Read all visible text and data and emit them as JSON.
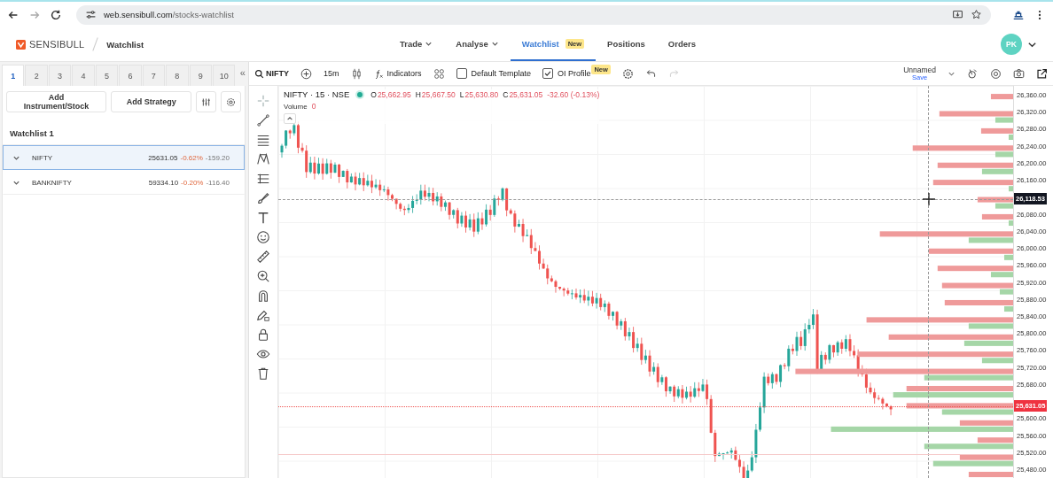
{
  "browser": {
    "url_host": "web.sensibull.com",
    "url_path": "/stocks-watchlist"
  },
  "header": {
    "logo": "SENSIBULL",
    "page": "Watchlist",
    "avatar": "PK",
    "nav": [
      {
        "label": "Trade",
        "dropdown": true,
        "selected": false
      },
      {
        "label": "Analyse",
        "dropdown": true,
        "selected": false
      },
      {
        "label": "Watchlist",
        "dropdown": false,
        "selected": true,
        "badge": "New"
      },
      {
        "label": "Positions",
        "dropdown": false,
        "selected": false
      },
      {
        "label": "Orders",
        "dropdown": false,
        "selected": false
      }
    ]
  },
  "watchlist": {
    "tabs": [
      {
        "label": "1",
        "selected": true
      },
      {
        "label": "2",
        "selected": false
      },
      {
        "label": "3",
        "selected": false
      },
      {
        "label": "4",
        "selected": false
      },
      {
        "label": "5",
        "selected": false
      },
      {
        "label": "6",
        "selected": false
      },
      {
        "label": "7",
        "selected": false
      },
      {
        "label": "8",
        "selected": false
      },
      {
        "label": "9",
        "selected": false
      },
      {
        "label": "10",
        "selected": false
      }
    ],
    "collapse": "«",
    "buttons": [
      "Add Instrument/Stock",
      "Add Strategy"
    ],
    "title": "Watchlist 1",
    "rows": [
      {
        "symbol": "NIFTY",
        "price": "25631.05",
        "change_pct": "-0.62%",
        "change": "-159.20",
        "selected": true
      },
      {
        "symbol": "BANKNIFTY",
        "price": "59334.10",
        "change_pct": "-0.20%",
        "change": "-116.40",
        "selected": false
      }
    ]
  },
  "chart_toolbar": {
    "symbol": "NIFTY",
    "interval": "15m",
    "indicators": "Indicators",
    "default_template": {
      "label": "Default Template",
      "checked": false
    },
    "oi_profile": {
      "label": "OI Profile",
      "checked": true,
      "badge": "New"
    },
    "layout_name": "Unnamed",
    "save": "Save"
  },
  "legend": {
    "title": "NIFTY · 15 · NSE",
    "ohlc": [
      {
        "label": "O",
        "value": "25,662.95"
      },
      {
        "label": "H",
        "value": "25,667.50"
      },
      {
        "label": "L",
        "value": "25,630.80"
      },
      {
        "label": "C",
        "value": "25,631.05"
      }
    ],
    "change": "-32.60 (-0.13%)",
    "volume_label": "Volume",
    "volume": "0"
  },
  "price_axis": {
    "ticks": [
      "26,360.00",
      "26,320.00",
      "26,280.00",
      "26,240.00",
      "26,200.00",
      "26,160.00",
      "26,080.00",
      "26,040.00",
      "26,000.00",
      "25,960.00",
      "25,920.00",
      "25,880.00",
      "25,840.00",
      "25,800.00",
      "25,760.00",
      "25,720.00",
      "25,680.00",
      "25,600.00",
      "25,560.00",
      "25,520.00",
      "25,480.00"
    ],
    "crosshair_price": "26,118.53",
    "last_price": "25,631.05"
  }
}
